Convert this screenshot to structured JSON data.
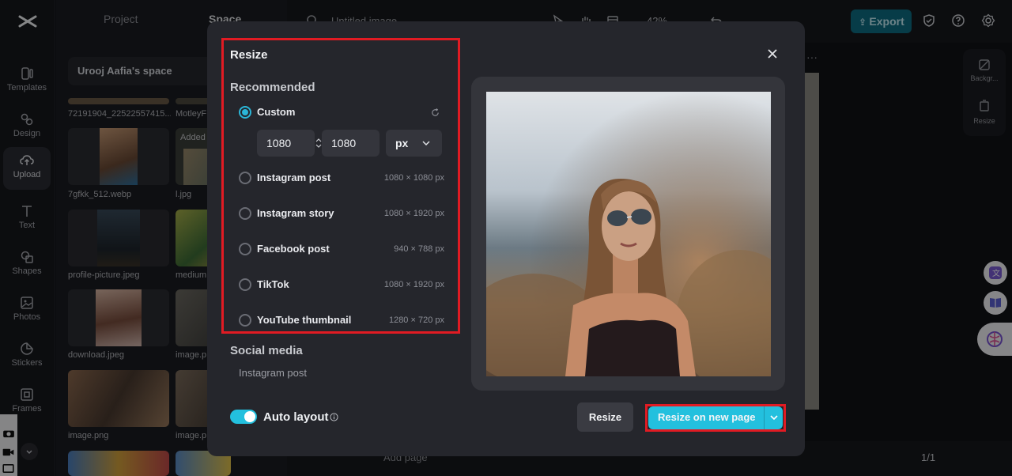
{
  "sidepanel": {
    "tabs": [
      "Project",
      "Space"
    ],
    "space_name": "Urooj Aafia's space",
    "files": [
      {
        "name": "72191904_22522557415..."
      },
      {
        "name": "MotleyF"
      },
      {
        "name": "7gfkk_512.webp"
      },
      {
        "name": "l.jpg",
        "badge": "Added"
      },
      {
        "name": "profile-picture.jpeg"
      },
      {
        "name": "medium"
      },
      {
        "name": "download.jpeg"
      },
      {
        "name": "image.p"
      },
      {
        "name": "image.png"
      },
      {
        "name": "image.p"
      }
    ]
  },
  "leftnav": {
    "items": [
      {
        "label": "Templates",
        "icon": "templates-icon"
      },
      {
        "label": "Design",
        "icon": "design-icon"
      },
      {
        "label": "Upload",
        "icon": "upload-icon"
      },
      {
        "label": "Text",
        "icon": "text-icon"
      },
      {
        "label": "Shapes",
        "icon": "shapes-icon"
      },
      {
        "label": "Photos",
        "icon": "photos-icon"
      },
      {
        "label": "Stickers",
        "icon": "stickers-icon"
      },
      {
        "label": "Frames",
        "icon": "frames-icon"
      }
    ]
  },
  "topbar": {
    "doc_title": "Untitled image",
    "zoom": "42%",
    "export_label": "Export"
  },
  "right_rail": {
    "background_label": "Backgr...",
    "resize_label": "Resize"
  },
  "canvas": {
    "add_page_label": "Add page",
    "page_counter": "1/1"
  },
  "modal": {
    "title": "Resize",
    "recommended_label": "Recommended",
    "custom_label": "Custom",
    "width_value": "1080",
    "height_value": "1080",
    "unit": "px",
    "options": [
      {
        "label": "Instagram post",
        "size": "1080 × 1080 px"
      },
      {
        "label": "Instagram story",
        "size": "1080 × 1920 px"
      },
      {
        "label": "Facebook post",
        "size": "940 × 788 px"
      },
      {
        "label": "TikTok",
        "size": "1080 × 1920 px"
      },
      {
        "label": "YouTube thumbnail",
        "size": "1280 × 720 px"
      }
    ],
    "social_media_label": "Social media",
    "social_first_item": "Instagram post",
    "auto_layout_label": "Auto layout",
    "resize_button": "Resize",
    "resize_new_page_button": "Resize on new page",
    "accent_color": "#23c0de",
    "highlight_color": "#e11b23"
  }
}
